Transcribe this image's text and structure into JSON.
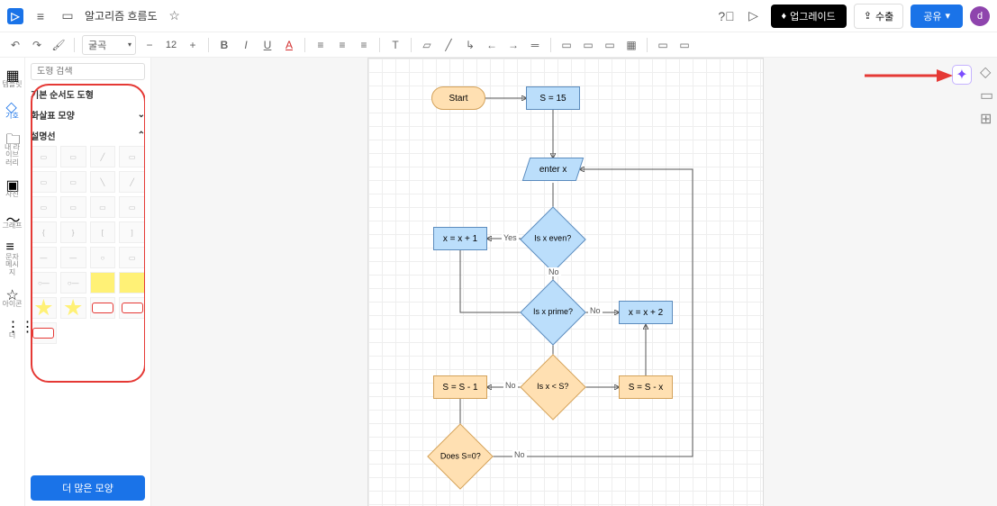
{
  "header": {
    "title": "알고리즘 흐름도",
    "upgrade": "업그레이드",
    "export": "수출",
    "share": "공유",
    "avatar": "d"
  },
  "toolbar": {
    "font": "굴곡",
    "size": "12"
  },
  "leftrail": {
    "items": [
      {
        "label": "템플릿"
      },
      {
        "label": "기호"
      },
      {
        "label": "내 라이브\n러리"
      },
      {
        "label": "사진"
      },
      {
        "label": "그래프"
      },
      {
        "label": "문자 메시\n지"
      },
      {
        "label": "아이콘"
      },
      {
        "label": "더"
      }
    ]
  },
  "panel": {
    "search_placeholder": "도형 검색",
    "cat1": "기본 순서도 도형",
    "cat2": "화살표 모양",
    "cat3": "설명선",
    "more": "더 많은 모양"
  },
  "flow": {
    "start": "Start",
    "s15": "S = 15",
    "enterx": "enter x",
    "even": "Is x\neven?",
    "xp1": "x = x + 1",
    "prime": "Is x\nprime?",
    "xp2": "x = x + 2",
    "less": "Is x < S?",
    "sm1": "S = S - 1",
    "smx": "S = S - x",
    "s0": "Does\nS=0?",
    "yes": "Yes",
    "no": "No"
  }
}
